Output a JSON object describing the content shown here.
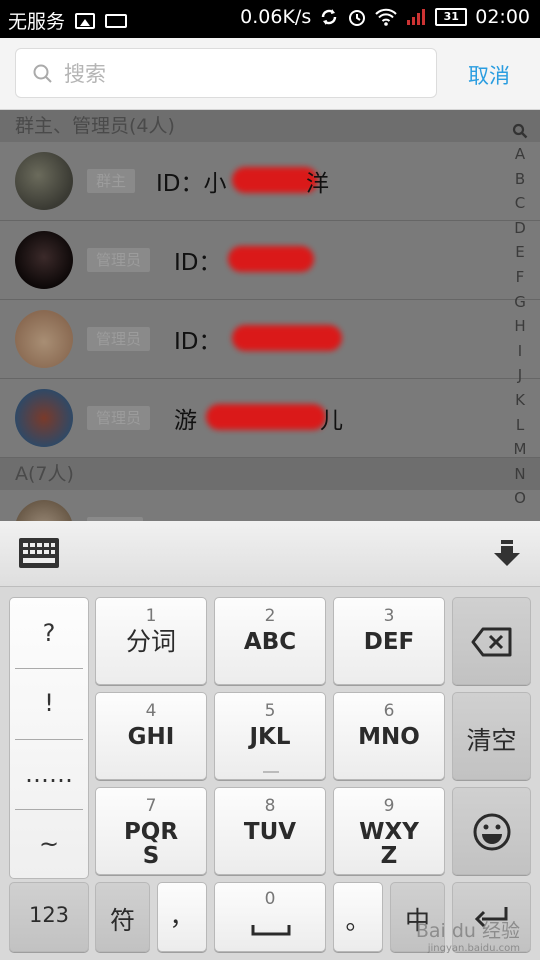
{
  "status_bar": {
    "carrier": "无服务",
    "speed": "0.06K/s",
    "battery": "31",
    "time": "02:00"
  },
  "search": {
    "placeholder": "搜索",
    "value": "",
    "cancel_label": "取消"
  },
  "sections": [
    {
      "title": "群主、管理员(4人)"
    },
    {
      "title": "A(7人)"
    }
  ],
  "members": [
    {
      "role": "群主",
      "name": "ID：小",
      "tail": "洋"
    },
    {
      "role": "管理员",
      "name": "ID：",
      "tail": ""
    },
    {
      "role": "管理员",
      "name": "ID：",
      "tail": ""
    },
    {
      "role": "管理员",
      "name": "游",
      "tail": "儿"
    }
  ],
  "index_letters": [
    "A",
    "B",
    "C",
    "D",
    "E",
    "F",
    "G",
    "H",
    "I",
    "J",
    "K",
    "L",
    "M",
    "N",
    "O"
  ],
  "keyboard": {
    "symbols": [
      "?",
      "!",
      "……",
      "~"
    ],
    "keys": [
      {
        "num": "1",
        "label": "分词"
      },
      {
        "num": "2",
        "label": "ABC"
      },
      {
        "num": "3",
        "label": "DEF"
      },
      {
        "num": "4",
        "label": "GHI"
      },
      {
        "num": "5",
        "label": "JKL"
      },
      {
        "num": "6",
        "label": "MNO"
      },
      {
        "num": "7",
        "label": "PQR",
        "label2": "S"
      },
      {
        "num": "8",
        "label": "TUV"
      },
      {
        "num": "9",
        "label": "WXY",
        "label2": "Z"
      }
    ],
    "clear_label": "清空",
    "num_label": "123",
    "sym_label": "符",
    "comma_label": "，",
    "zero_num": "0",
    "period_label": "。",
    "lang_label": "中",
    "watermark": "Bai du 经验",
    "watermark_sub": "jingyan.baidu.com"
  },
  "colors": {
    "accent": "#2a9de0",
    "redaction": "#e01414"
  }
}
